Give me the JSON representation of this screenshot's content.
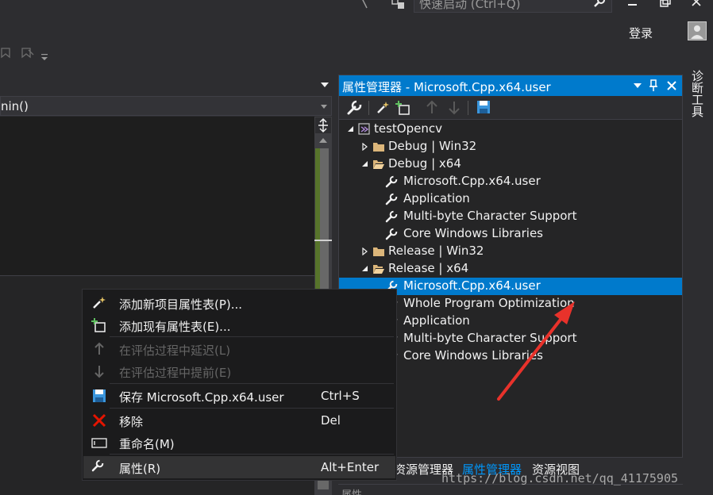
{
  "titlebar": {
    "quick_launch_placeholder": "快速启动 (Ctrl+Q)",
    "login_label": "登录"
  },
  "editor": {
    "function_combo": "nin()"
  },
  "property_manager": {
    "title": "属性管理器 - Microsoft.Cpp.x64.user",
    "tree": [
      {
        "label": "testOpencv",
        "level": 0,
        "expanded": true,
        "icon": "project-icon"
      },
      {
        "label": "Debug | Win32",
        "level": 1,
        "expanded": false,
        "icon": "folder-icon"
      },
      {
        "label": "Debug | x64",
        "level": 1,
        "expanded": true,
        "icon": "folder-open-icon"
      },
      {
        "label": "Microsoft.Cpp.x64.user",
        "level": 2,
        "icon": "wrench-icon"
      },
      {
        "label": "Application",
        "level": 2,
        "icon": "wrench-icon"
      },
      {
        "label": "Multi-byte Character Support",
        "level": 2,
        "icon": "wrench-icon"
      },
      {
        "label": "Core Windows Libraries",
        "level": 2,
        "icon": "wrench-icon"
      },
      {
        "label": "Release | Win32",
        "level": 1,
        "expanded": false,
        "icon": "folder-icon"
      },
      {
        "label": "Release | x64",
        "level": 1,
        "expanded": true,
        "icon": "folder-open-icon"
      },
      {
        "label": "Microsoft.Cpp.x64.user",
        "level": 2,
        "icon": "wrench-icon",
        "selected": true
      },
      {
        "label": "Whole Program Optimization",
        "level": 2,
        "icon": "wrench-icon"
      },
      {
        "label": "Application",
        "level": 2,
        "icon": "wrench-icon"
      },
      {
        "label": "Multi-byte Character Support",
        "level": 2,
        "icon": "wrench-icon"
      },
      {
        "label": "Core Windows Libraries",
        "level": 2,
        "icon": "wrench-icon"
      }
    ],
    "tabs": [
      "资源管理器",
      "属性管理器",
      "资源视图"
    ],
    "active_tab": "属性管理器",
    "next_panel_title": "属性"
  },
  "side_tab": {
    "label": "诊断工具"
  },
  "context_menu": {
    "items": [
      {
        "label": "添加新项目属性表(P)...",
        "shortcut": "",
        "enabled": true,
        "icon": "add-new-sheet-icon"
      },
      {
        "label": "添加现有属性表(E)...",
        "shortcut": "",
        "enabled": true,
        "icon": "add-existing-sheet-icon"
      },
      {
        "label": "在评估过程中延迟(L)",
        "shortcut": "",
        "enabled": false,
        "icon": "arrow-up-icon"
      },
      {
        "label": "在评估过程中提前(E)",
        "shortcut": "",
        "enabled": false,
        "icon": "arrow-down-icon"
      },
      {
        "label": "保存 Microsoft.Cpp.x64.user",
        "shortcut": "Ctrl+S",
        "enabled": true,
        "icon": "save-icon"
      },
      {
        "label": "移除",
        "shortcut": "Del",
        "enabled": true,
        "icon": "remove-x-icon"
      },
      {
        "label": "重命名(M)",
        "shortcut": "",
        "enabled": true,
        "icon": "rename-icon"
      },
      {
        "label": "属性(R)",
        "shortcut": "Alt+Enter",
        "enabled": true,
        "icon": "wrench-icon",
        "hover": true
      }
    ]
  },
  "watermark": "https://blog.csdn.net/qq_41175905",
  "colors": {
    "accent": "#007acc",
    "background": "#2d2d30",
    "menu_bg": "#1b1b1c",
    "annotation_arrow": "#e8322b"
  }
}
